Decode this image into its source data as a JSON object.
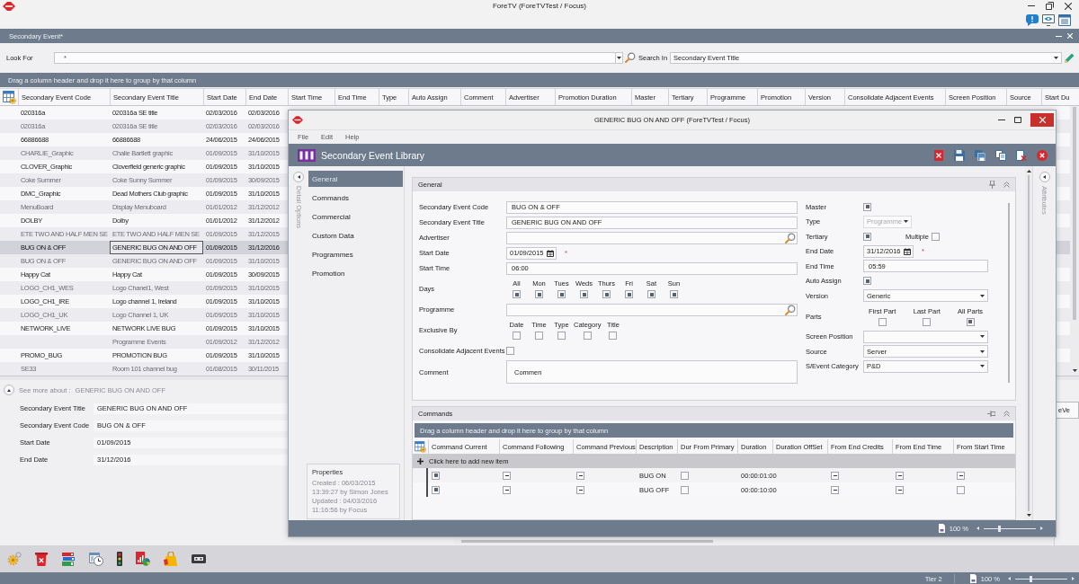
{
  "window": {
    "title": "ForeTV (ForeTVTest / Focus)"
  },
  "panel": {
    "title": "Secondary Event*"
  },
  "search": {
    "look_for_label": "Look For",
    "look_for_value": "*",
    "search_in_label": "Search In",
    "search_in_value": "Secondary Event Title"
  },
  "group_hint": "Drag a column header and drop it here to group by that column",
  "table": {
    "columns": [
      "Secondary Event Code",
      "Secondary Event Title",
      "Start Date",
      "End Date",
      "Start Time",
      "End Time",
      "Type",
      "Auto Assign",
      "Comment",
      "Advertiser",
      "Promotion Duration",
      "Master",
      "Tertiary",
      "Programme",
      "Promotion",
      "Version",
      "Consolidate Adjacent Events",
      "Screen Position",
      "Source",
      "Start Du"
    ],
    "rows": [
      {
        "code": "020316a",
        "title": "020316a SE title",
        "start_date": "02/03/2016",
        "end_date": "02/03/2016",
        "selected": false,
        "focused": false
      },
      {
        "code": "020316a",
        "title": "020316a SE title",
        "start_date": "02/03/2016",
        "end_date": "02/03/2016",
        "selected": false,
        "focused": false
      },
      {
        "code": "66886688",
        "title": "66886688",
        "start_date": "24/06/2015",
        "end_date": "24/06/2015",
        "selected": false,
        "focused": false
      },
      {
        "code": "CHARLIE_Graphic",
        "title": "Chalie Bartlett graphic",
        "start_date": "01/09/2015",
        "end_date": "31/10/2015",
        "selected": false,
        "focused": false
      },
      {
        "code": "CLOVER_Graphic",
        "title": "Cloverfield generic graphic",
        "start_date": "01/09/2015",
        "end_date": "31/10/2015",
        "selected": false,
        "focused": false
      },
      {
        "code": "Coke Summer",
        "title": "Coke Sunny Summer",
        "start_date": "01/09/2015",
        "end_date": "30/09/2015",
        "selected": false,
        "focused": false
      },
      {
        "code": "DMC_Graphic",
        "title": "Dead Mothers Club graphic",
        "start_date": "01/09/2015",
        "end_date": "31/10/2015",
        "selected": false,
        "focused": false
      },
      {
        "code": "MenuBoard",
        "title": "Display Menuboard",
        "start_date": "01/01/2012",
        "end_date": "31/12/2012",
        "selected": false,
        "focused": false
      },
      {
        "code": "DOLBY",
        "title": "Dolby",
        "start_date": "01/01/2012",
        "end_date": "31/12/2012",
        "selected": false,
        "focused": false
      },
      {
        "code": "ETE TWO AND HALF MEN SE",
        "title": "ETE TWO AND HALF MEN SE",
        "start_date": "01/09/2015",
        "end_date": "31/12/2015",
        "selected": false,
        "focused": false
      },
      {
        "code": "BUG ON & OFF",
        "title": "GENERIC BUG ON AND OFF",
        "start_date": "01/09/2015",
        "end_date": "31/12/2016",
        "selected": true,
        "focused": true
      },
      {
        "code": "BUG ON & OFF",
        "title": "GENERIC BUG ON AND OFF",
        "start_date": "01/09/2015",
        "end_date": "31/10/2015",
        "selected": false,
        "focused": false
      },
      {
        "code": "Happy Cat",
        "title": "Happy Cat",
        "start_date": "01/09/2015",
        "end_date": "30/09/2015",
        "selected": false,
        "focused": false
      },
      {
        "code": "LOGO_CH1_WES",
        "title": "Logo Chanel1, West",
        "start_date": "01/09/2015",
        "end_date": "31/10/2015",
        "selected": false,
        "focused": false
      },
      {
        "code": "LOGO_CH1_IRE",
        "title": "Logo channel 1, Ireland",
        "start_date": "01/09/2015",
        "end_date": "31/10/2015",
        "selected": false,
        "focused": false
      },
      {
        "code": "LOGO_CH1_UK",
        "title": "Logo Channel 1, UK",
        "start_date": "01/09/2015",
        "end_date": "31/10/2015",
        "selected": false,
        "focused": false
      },
      {
        "code": "NETWORK_LIVE",
        "title": "NETWORK LIVE BUG",
        "start_date": "01/09/2015",
        "end_date": "31/10/2015",
        "selected": false,
        "focused": false
      },
      {
        "title": "Programme Events",
        "start_date": "01/09/2012",
        "end_date": "31/12/2012",
        "selected": false,
        "focused": false
      },
      {
        "code": "PROMO_BUG",
        "title": "PROMOTION BUG",
        "start_date": "01/09/2015",
        "end_date": "31/10/2015",
        "selected": false,
        "focused": false
      },
      {
        "code": "SE33",
        "title": "Room 101 channel bug",
        "start_date": "01/08/2015",
        "end_date": "30/11/2015",
        "selected": false,
        "focused": false
      }
    ]
  },
  "details": {
    "toggle_label": "See more about :",
    "toggle_value": "GENERIC BUG ON AND OFF",
    "fields": [
      {
        "label": "Secondary Event Title",
        "value": "GENERIC BUG ON AND OFF"
      },
      {
        "label": "Secondary Event Code",
        "value": "BUG ON & OFF"
      },
      {
        "label": "Start Date",
        "value": "01/09/2015"
      },
      {
        "label": "End Date",
        "value": "31/12/2016"
      }
    ],
    "side_tab": "eVe"
  },
  "status_bar": {
    "tier": "Tier 2",
    "zoom": {
      "reading": "100 %",
      "level": 0.3
    }
  },
  "dialog": {
    "title": "GENERIC BUG ON AND OFF (ForeTVTest / Focus)",
    "menu": [
      "File",
      "Edit",
      "Help"
    ],
    "header": "Secondary Event Library",
    "side_label": "Detail Options",
    "nav": [
      {
        "label": "General",
        "selected": true
      },
      {
        "label": "Commands",
        "selected": false
      },
      {
        "label": "Commercial",
        "selected": false
      },
      {
        "label": "Custom Data",
        "selected": false
      },
      {
        "label": "Programmes",
        "selected": false
      },
      {
        "label": "Promotion",
        "selected": false
      }
    ],
    "properties": {
      "title": "Properties",
      "lines": [
        "Created : 06/03/2015",
        "13:39:27 by Simon Jones",
        "Updated : 04/03/2016",
        "11:16:56 by Focus"
      ]
    },
    "attributes_label": "Attributes",
    "general": {
      "title": "General",
      "left": [
        {
          "kind": "text",
          "label": "Secondary Event Code",
          "value": "BUG ON & OFF"
        },
        {
          "kind": "text",
          "label": "Secondary Event Title",
          "value": "GENERIC BUG ON AND OFF"
        },
        {
          "kind": "lookup",
          "label": "Advertiser"
        },
        {
          "kind": "date",
          "label": "Start Date",
          "value": "01/09/2015",
          "required_mark": "*"
        },
        {
          "kind": "text",
          "label": "Start Time",
          "value": "06:00"
        },
        {
          "kind": "checks",
          "label": "Days",
          "options": [
            {
              "label": "All",
              "checked": true
            },
            {
              "label": "Mon",
              "checked": true
            },
            {
              "label": "Tues",
              "checked": true
            },
            {
              "label": "Weds",
              "checked": true
            },
            {
              "label": "Thurs",
              "checked": true
            },
            {
              "label": "Fri",
              "checked": true
            },
            {
              "label": "Sat",
              "checked": true
            },
            {
              "label": "Sun",
              "checked": true
            }
          ]
        },
        {
          "kind": "lookup",
          "label": "Programme"
        },
        {
          "kind": "checks",
          "label": "Exclusive By",
          "options": [
            {
              "label": "Date",
              "checked": false
            },
            {
              "label": "Time",
              "checked": false
            },
            {
              "label": "Type",
              "checked": false
            },
            {
              "label": "Category",
              "checked": false
            },
            {
              "label": "Title",
              "checked": false
            }
          ]
        },
        {
          "kind": "checkbox",
          "label": "Consolidate Adjacent Events",
          "checked": false
        },
        {
          "kind": "textarea",
          "label": "Comment",
          "value": "Commen"
        }
      ],
      "right": [
        {
          "kind": "checkbox",
          "label": "Master",
          "checked": true
        },
        {
          "kind": "select",
          "label": "Type",
          "value": "Programme",
          "disabled": true
        },
        {
          "kind": "checkbox",
          "label": "Tertiary",
          "checked": true,
          "extra": {
            "label": "Multiple",
            "checked": false
          }
        },
        {
          "kind": "date",
          "label": "End Date",
          "value": "31/12/2016",
          "required_mark": "*"
        },
        {
          "kind": "text",
          "label": "End Time",
          "value": "05:59"
        },
        {
          "kind": "checkbox",
          "label": "Auto Assign",
          "checked": true
        },
        {
          "kind": "select",
          "label": "Version",
          "value": "Generic",
          "disabled": false
        },
        {
          "kind": "parts",
          "label": "Parts",
          "options": [
            {
              "label": "First Part",
              "checked": false
            },
            {
              "label": "Last Part",
              "checked": false
            },
            {
              "label": "All Parts",
              "checked": true
            }
          ]
        },
        {
          "kind": "select",
          "label": "Screen Position",
          "disabled": false
        },
        {
          "kind": "select",
          "label": "Source",
          "value": "Server",
          "disabled": false
        },
        {
          "kind": "select",
          "label": "S/Event Category",
          "value": "P&D",
          "disabled": false
        }
      ]
    },
    "commands": {
      "title": "Commands",
      "group_hint": "Drag a column header and drop it here to group by that column",
      "columns": [
        "Command Current",
        "Command Following",
        "Command Previous",
        "Description",
        "Dur From Primary",
        "Duration",
        "Duration OffSet",
        "From End Credits",
        "From End Time",
        "From Start Time"
      ],
      "add_row": "Click here to add new item",
      "rows": [
        {
          "cells": [
            {
              "kind": "check",
              "checked": true
            },
            {
              "kind": "tristate",
              "indeterminate": true
            },
            {
              "kind": "tristate",
              "indeterminate": true
            },
            {
              "kind": "text",
              "text": "BUG ON"
            },
            {
              "kind": "check",
              "checked": false
            },
            {
              "kind": "text",
              "text": "00:00:01:00"
            },
            null,
            {
              "kind": "tristate",
              "indeterminate": true
            },
            {
              "kind": "tristate",
              "indeterminate": true
            },
            {
              "kind": "tristate",
              "indeterminate": true
            }
          ]
        },
        {
          "cells": [
            {
              "kind": "check",
              "checked": true
            },
            {
              "kind": "tristate",
              "indeterminate": true
            },
            {
              "kind": "tristate",
              "indeterminate": true
            },
            {
              "kind": "text",
              "text": "BUG OFF"
            },
            {
              "kind": "check",
              "checked": false
            },
            {
              "kind": "text",
              "text": "00:00:10:00"
            },
            null,
            {
              "kind": "tristate",
              "indeterminate": true
            },
            {
              "kind": "tristate",
              "indeterminate": true
            },
            {
              "kind": "check",
              "checked": false
            }
          ]
        }
      ]
    },
    "zoom": {
      "reading": "100 %",
      "level": 0.3
    }
  }
}
